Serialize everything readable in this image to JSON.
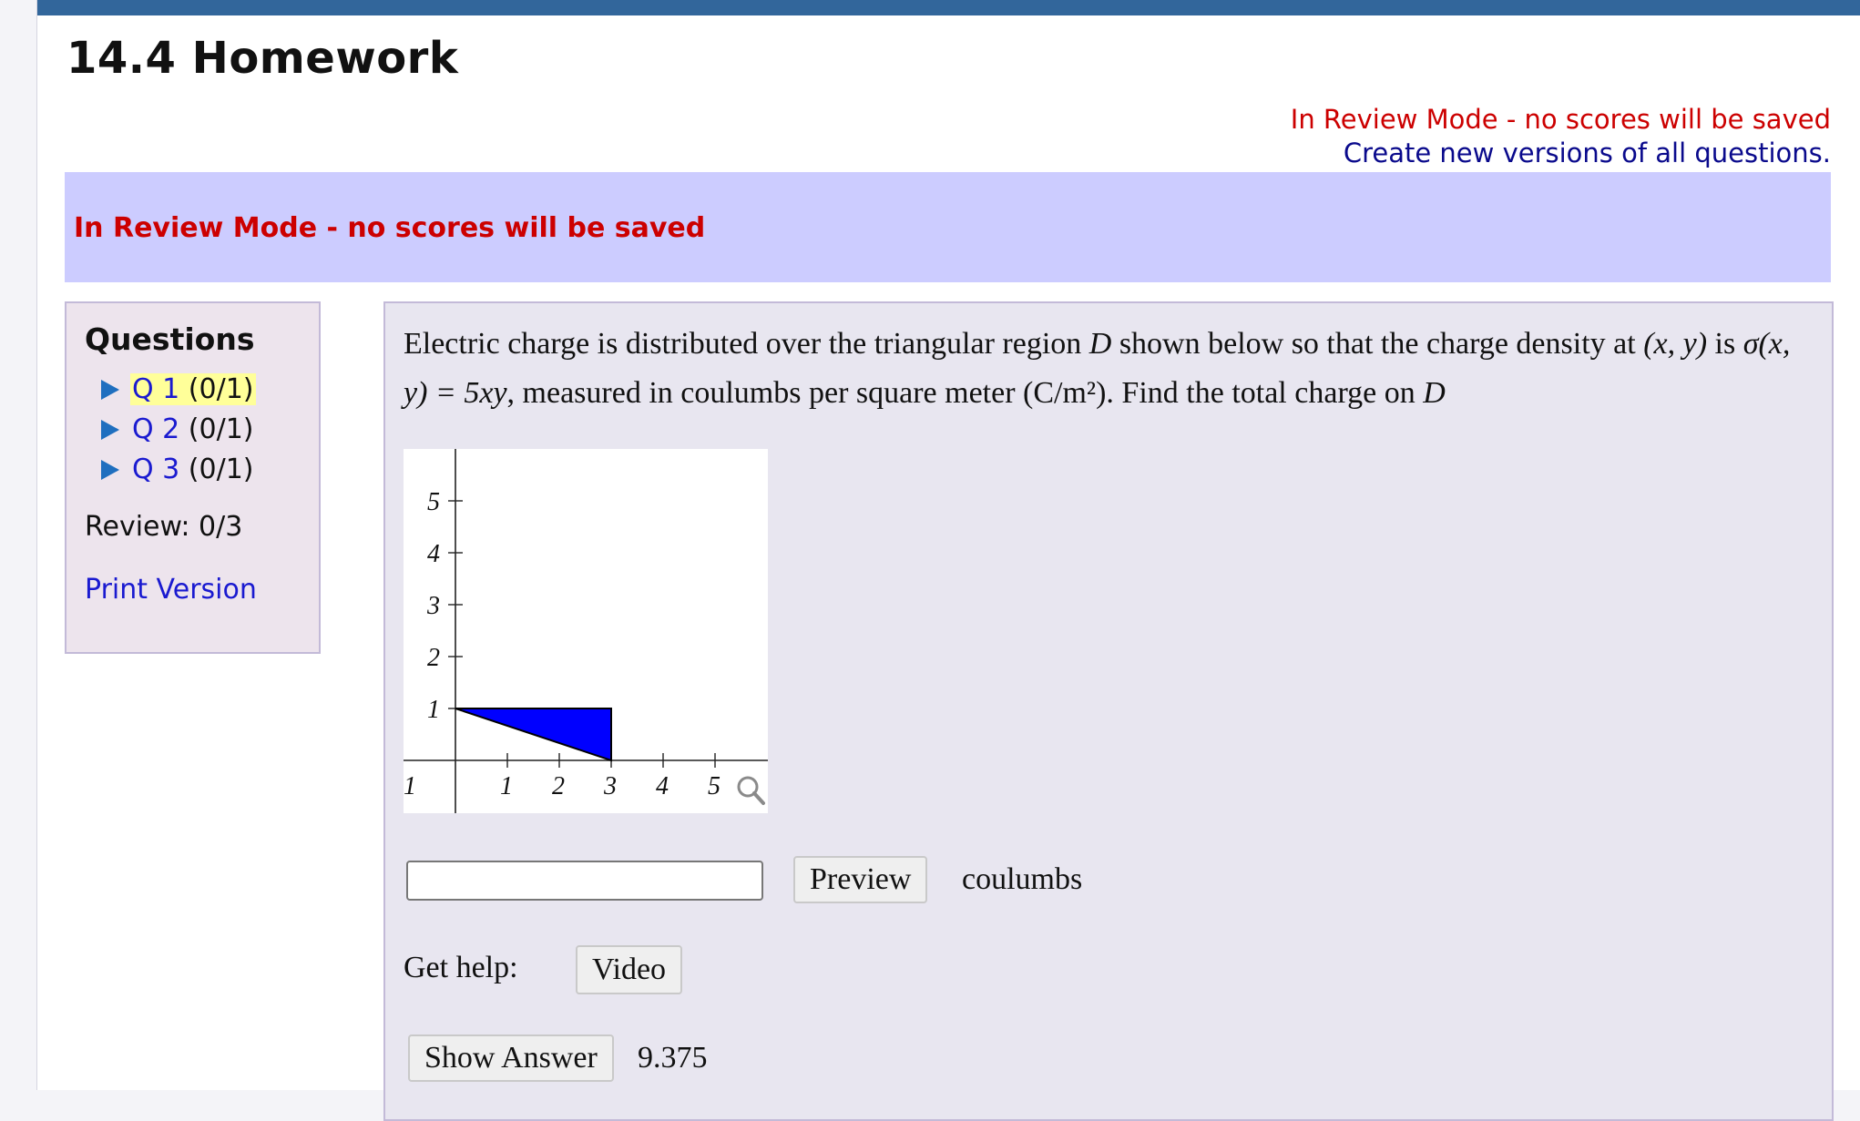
{
  "page": {
    "title": "14.4 Homework",
    "review_notice": "In Review Mode - no scores will be saved",
    "new_versions_link": "Create new versions of all questions.",
    "banner_text": "In Review Mode - no scores will be saved"
  },
  "sidebar": {
    "heading": "Questions",
    "questions": [
      {
        "label": "Q 1",
        "score": "(0/1)",
        "current": true
      },
      {
        "label": "Q 2",
        "score": "(0/1)",
        "current": false
      },
      {
        "label": "Q 3",
        "score": "(0/1)",
        "current": false
      }
    ],
    "review_score": "Review: 0/3",
    "print_version": "Print Version"
  },
  "question": {
    "text_part1": "Electric charge is distributed over the triangular region ",
    "region": "D",
    "text_part2": " shown below so that the charge density at ",
    "point": "(x, y)",
    "text_part3": " is ",
    "density": "σ(x, y) = 5xy",
    "text_part4": ", measured in coulumbs per square meter (C/m²). Find the total charge on ",
    "region2": "D"
  },
  "graph": {
    "x_ticks": [
      "1",
      "1",
      "2",
      "3",
      "4",
      "5"
    ],
    "y_ticks": [
      "5",
      "4",
      "3",
      "2",
      "1"
    ],
    "triangle_vertices": [
      [
        0,
        1
      ],
      [
        3,
        1
      ],
      [
        3,
        0
      ]
    ],
    "fill_color": "#0000ff",
    "zoom_icon": "magnifier-icon"
  },
  "answer": {
    "input_value": "",
    "preview_label": "Preview",
    "units": "coulumbs",
    "help_label": "Get help:",
    "video_label": "Video",
    "show_answer_label": "Show Answer",
    "answer_value": "9.375"
  }
}
